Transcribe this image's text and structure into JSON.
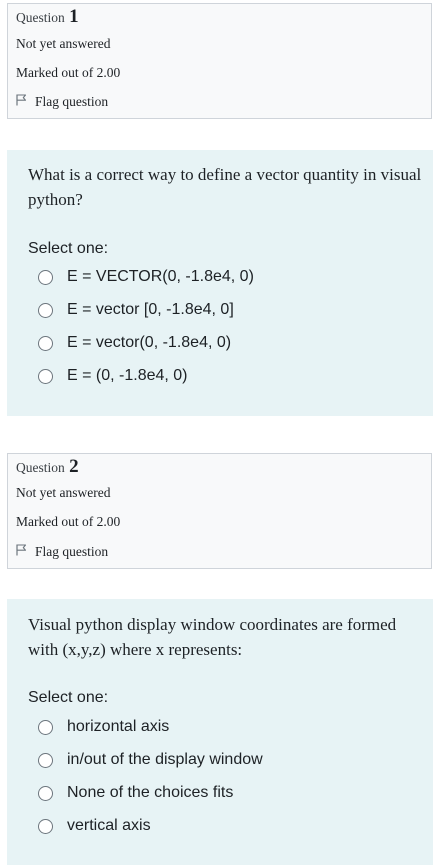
{
  "questions": [
    {
      "label": "Question",
      "number": "1",
      "state": "Not yet answered",
      "grade": "Marked out of 2.00",
      "flag_label": "Flag question",
      "text": "What is a correct way to define a vector quantity in visual python?",
      "prompt": "Select one:",
      "options": [
        "E = VECTOR(0, -1.8e4, 0)",
        "E = vector [0, -1.8e4, 0]",
        "E = vector(0, -1.8e4, 0)",
        "E = (0, -1.8e4, 0)"
      ]
    },
    {
      "label": "Question",
      "number": "2",
      "state": "Not yet answered",
      "grade": "Marked out of 2.00",
      "flag_label": "Flag question",
      "text": "Visual python display window coordinates are formed with (x,y,z) where x represents:",
      "prompt": "Select one:",
      "options": [
        "horizontal axis",
        "in/out of the display window",
        "None of the choices fits",
        "vertical axis"
      ]
    }
  ],
  "icons": {
    "flag": "flag-outline-icon",
    "radio": "radio-unselected"
  },
  "colors": {
    "info_bg": "#f8f9fa",
    "info_border": "#cfd4da",
    "content_bg": "#e7f3f5",
    "text": "#1d2125"
  }
}
